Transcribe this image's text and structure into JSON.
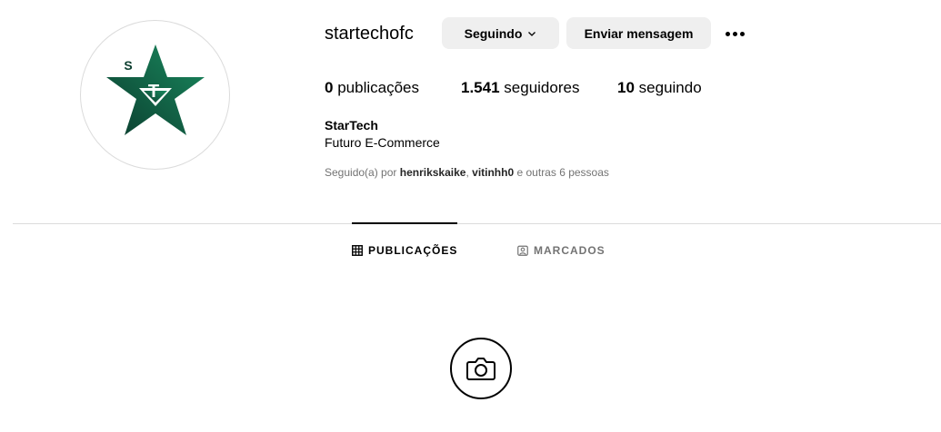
{
  "profile": {
    "username": "startechofc",
    "full_name": "StarTech",
    "bio": "Futuro E-Commerce",
    "logo_colors": {
      "dark": "#0b3d2e",
      "light": "#1a8a5f"
    },
    "logo_letters": {
      "s": "S",
      "t": "T"
    }
  },
  "actions": {
    "following_label": "Seguindo",
    "message_label": "Enviar mensagem",
    "more_icon": "more-horizontal-icon"
  },
  "stats": {
    "posts_count": "0",
    "posts_label": "publicações",
    "followers_count": "1.541",
    "followers_label": "seguidores",
    "following_count": "10",
    "following_label": "seguindo"
  },
  "followed_by": {
    "prefix": "Seguido(a) por",
    "user1": "henrikskaike",
    "separator": ",",
    "user2": "vitinhh0",
    "suffix": "e outras 6 pessoas"
  },
  "tabs": [
    {
      "label": "PUBLICAÇÕES",
      "icon": "grid-icon",
      "active": true
    },
    {
      "label": "MARCADOS",
      "icon": "tagged-icon",
      "active": false
    }
  ],
  "empty_state": {
    "icon": "camera-icon"
  }
}
